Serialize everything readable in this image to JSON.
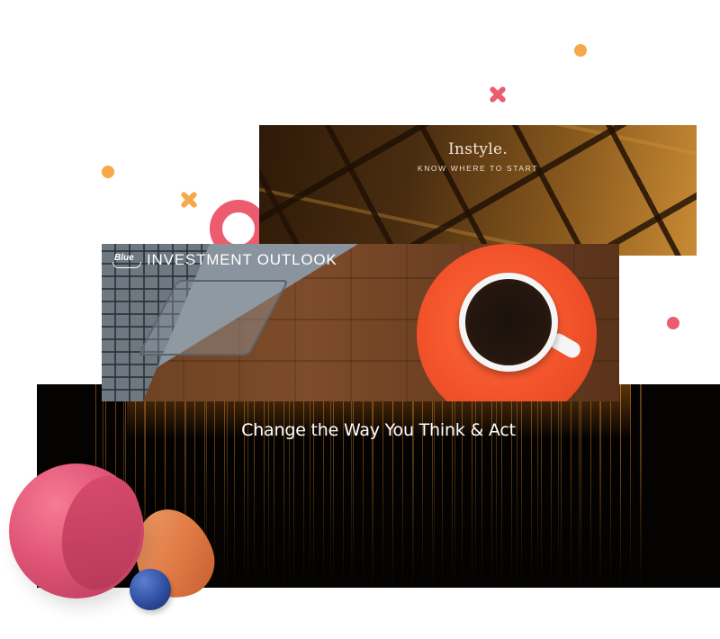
{
  "banners": {
    "instyle": {
      "title": "Instyle.",
      "subtitle": "KNOW WHERE TO START"
    },
    "investment": {
      "logo_text": "Blue",
      "title": "INVESTMENT OUTLOOK"
    },
    "change": {
      "title": "Change the Way You Think & Act"
    }
  },
  "colors": {
    "accent_pink": "#ec5b6e",
    "accent_orange": "#f7a84a",
    "saucer_orange": "#f2522a",
    "banner_dark": "#050302"
  },
  "decorations": {
    "icons": [
      "cross-icon",
      "dot-icon",
      "half-ring-icon"
    ]
  }
}
